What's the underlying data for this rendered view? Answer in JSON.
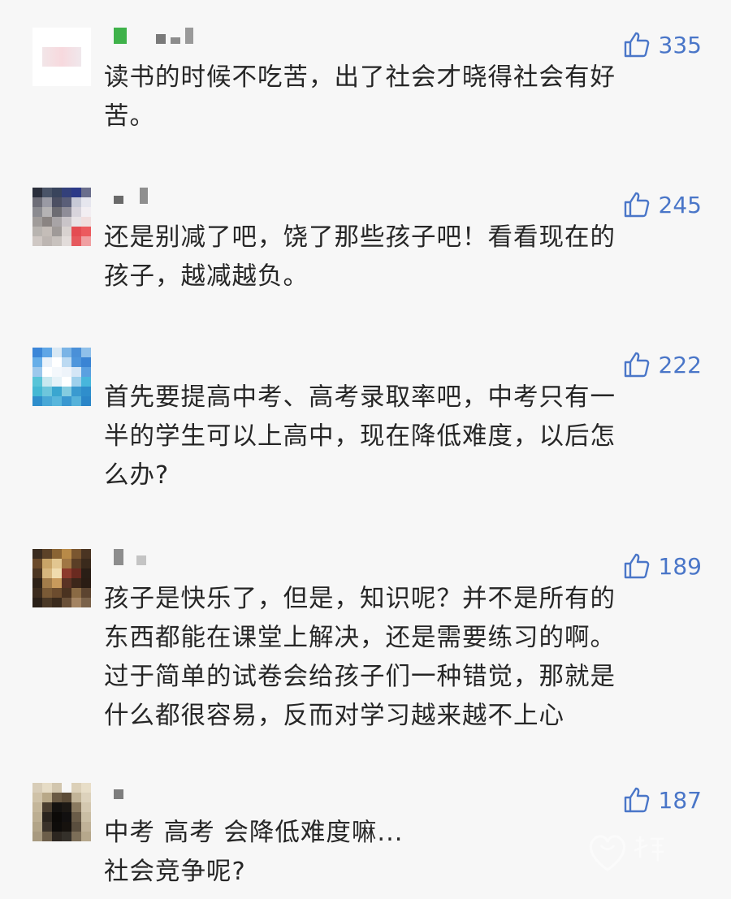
{
  "comments": [
    {
      "likes": "335",
      "text": "读书的时候不吃苦，出了社会才晓得社会有好\n苦。"
    },
    {
      "likes": "245",
      "text": "还是别减了吧，饶了那些孩子吧！看看现在的\n孩子，越减越负。"
    },
    {
      "likes": "222",
      "text": "首先要提高中考、高考录取率吧，中考只有一\n半的学生可以上高中，现在降低难度，以后怎\n么办?"
    },
    {
      "likes": "189",
      "text": "孩子是快乐了，但是，知识呢？并不是所有的\n东西都能在课堂上解决，还是需要练习的啊。\n过于简单的试卷会给孩子们一种错觉，那就是\n什么都很容易，反而对学习越来越不上心"
    },
    {
      "likes": "187",
      "text": "中考 高考 会降低难度嘛...\n社会竞争呢?"
    }
  ],
  "colors": {
    "like": "#4a76c8",
    "text": "#262626",
    "background": "#f7f7f7"
  },
  "icons": {
    "like": "thumbs-up-icon",
    "watermark": "heart-logo-icon"
  }
}
